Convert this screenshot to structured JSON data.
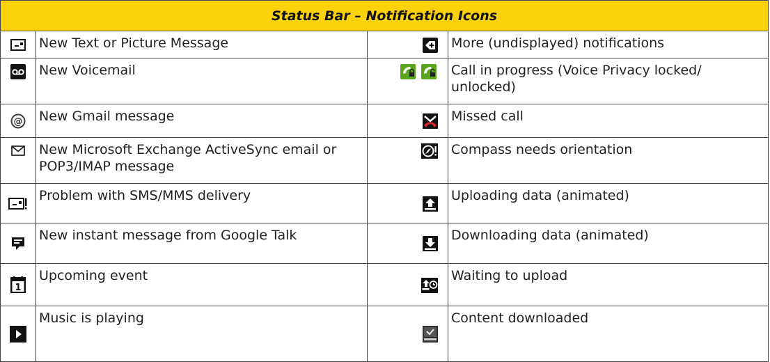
{
  "header": {
    "title": "Status Bar – Notification Icons"
  },
  "rows": [
    {
      "left_icon": "text-message-icon",
      "left_label": "New Text or Picture Message",
      "right_icon": "more-notifications-icon",
      "right_label": "More (undisplayed) notifications"
    },
    {
      "left_icon": "voicemail-icon",
      "left_label": "New Voicemail",
      "right_icon": "call-in-progress-icon",
      "right_label": "Call in progress (Voice Privacy locked/ unlocked)"
    },
    {
      "left_icon": "gmail-icon",
      "left_label": "New Gmail message",
      "right_icon": "missed-call-icon",
      "right_label": "Missed call"
    },
    {
      "left_icon": "email-envelope-icon",
      "left_label": "New Microsoft Exchange ActiveSync email or POP3/IMAP message",
      "right_icon": "compass-icon",
      "right_label": "Compass needs orientation"
    },
    {
      "left_icon": "sms-problem-icon",
      "left_label": "Problem with SMS/MMS delivery",
      "right_icon": "upload-icon",
      "right_label": "Uploading data (animated)"
    },
    {
      "left_icon": "google-talk-icon",
      "left_label": "New instant message from Google Talk",
      "right_icon": "download-icon",
      "right_label": "Downloading data (animated)"
    },
    {
      "left_icon": "calendar-event-icon",
      "left_label": "Upcoming event",
      "right_icon": "waiting-upload-icon",
      "right_label": "Waiting to upload"
    },
    {
      "left_icon": "music-playing-icon",
      "left_label": "Music is playing",
      "right_icon": "content-downloaded-icon",
      "right_label": "Content downloaded"
    }
  ]
}
